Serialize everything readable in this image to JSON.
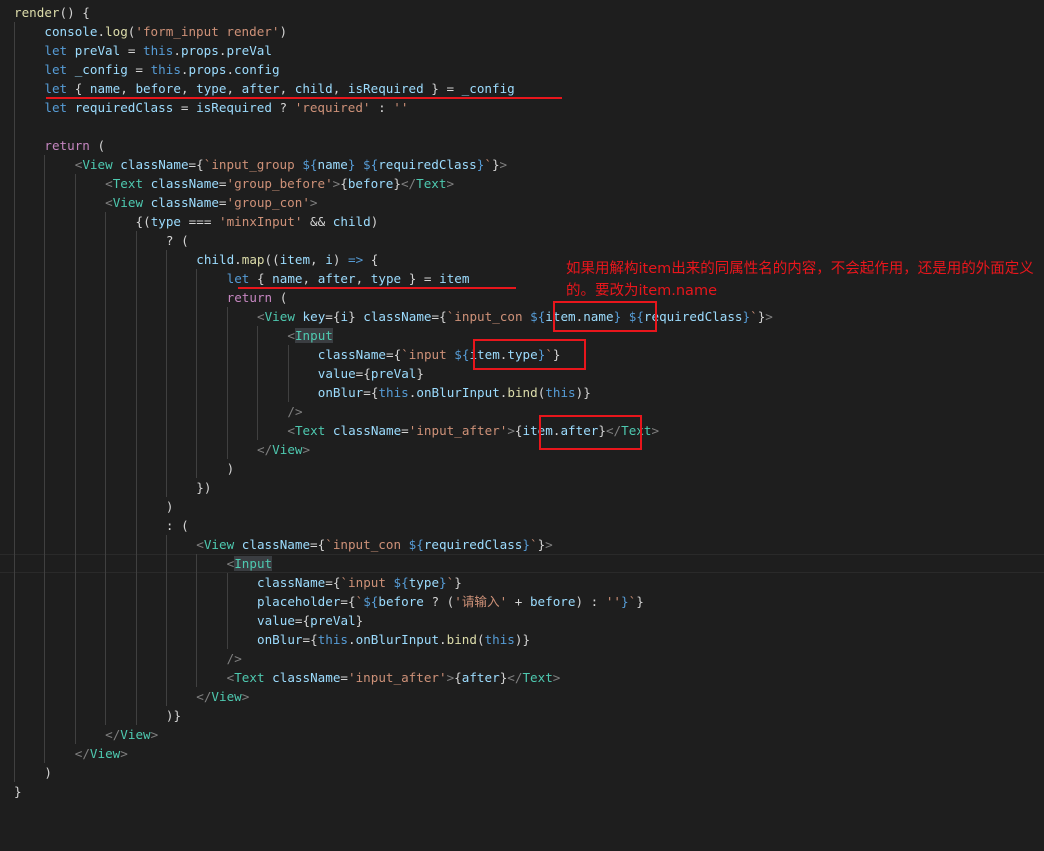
{
  "colors": {
    "background": "#1e1e1e",
    "annotation": "#e8161c"
  },
  "annotation_text": "如果用解构item出来的同属性名的内容，不会起作用，还是用的外面定义的。要改为item.name",
  "code_lines": [
    "render() {",
    "    console.log('form_input render')",
    "    let preVal = this.props.preVal",
    "    let _config = this.props.config",
    "    let { name, before, type, after, child, isRequired } = _config",
    "    let requiredClass = isRequired ? 'required' : ''",
    "",
    "    return (",
    "        <View className={`input_group ${name} ${requiredClass}`}>",
    "            <Text className='group_before'>{before}</Text>",
    "            <View className='group_con'>",
    "                {(type === 'minxInput' && child)",
    "                    ? (",
    "                        child.map((item, i) => {",
    "                            let { name, after, type } = item",
    "                            return (",
    "                                <View key={i} className={`input_con ${item.name} ${requiredClass}`}>",
    "                                    <Input",
    "                                        className={`input ${item.type}`}",
    "                                        value={preVal}",
    "                                        onBlur={this.onBlurInput.bind(this)}",
    "                                    />",
    "                                    <Text className='input_after'>{item.after}</Text>",
    "                                </View>",
    "                            )",
    "                        })",
    "                    )",
    "                    : (",
    "                        <View className={`input_con ${requiredClass}`}>",
    "                            <Input",
    "                                className={`input ${type}`}",
    "                                placeholder={`${before ? ('请输入' + before) : ''}`}",
    "                                value={preVal}",
    "                                onBlur={this.onBlurInput.bind(this)}",
    "                            />",
    "                            <Text className='input_after'>{after}</Text>",
    "                        </View>",
    "                    )}",
    "            </View>",
    "        </View>",
    "    )",
    "}"
  ]
}
